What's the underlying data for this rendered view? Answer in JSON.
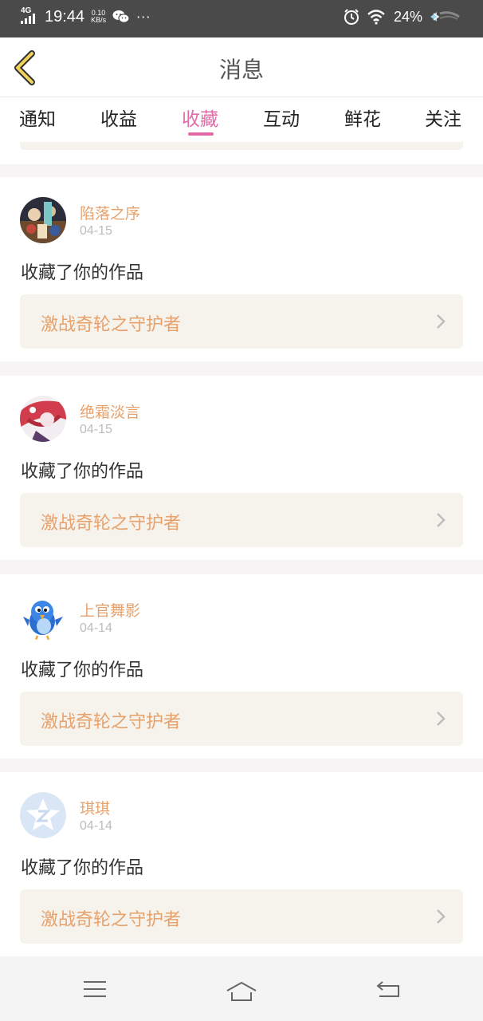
{
  "status_bar": {
    "network": "4G",
    "time": "19:44",
    "speed_value": "0.10",
    "speed_unit": "KB/s",
    "more": "···",
    "battery": "24%"
  },
  "header": {
    "title": "消息"
  },
  "tabs": [
    {
      "label": "通知"
    },
    {
      "label": "收益"
    },
    {
      "label": "收藏"
    },
    {
      "label": "互动"
    },
    {
      "label": "鲜花"
    },
    {
      "label": "关注"
    }
  ],
  "active_tab": "收藏",
  "messages": [
    {
      "user": "陷落之序",
      "date": "04-15",
      "action": "收藏了你的作品",
      "work": "激战奇轮之守护者"
    },
    {
      "user": "绝霜淡言",
      "date": "04-15",
      "action": "收藏了你的作品",
      "work": "激战奇轮之守护者"
    },
    {
      "user": "上官舞影",
      "date": "04-14",
      "action": "收藏了你的作品",
      "work": "激战奇轮之守护者"
    },
    {
      "user": "琪琪",
      "date": "04-14",
      "action": "收藏了你的作品",
      "work": "激战奇轮之守护者"
    }
  ],
  "colors": {
    "accent_pink": "#e36aa8",
    "name_orange": "#e8a16b",
    "card_bg": "#f5f3ec",
    "status_bar": "#4a4a4a"
  },
  "icons": [
    "back-icon",
    "wechat-icon",
    "alarm-icon",
    "wifi-icon",
    "battery-icon",
    "chevron-right-icon",
    "menu-icon",
    "home-icon",
    "return-icon"
  ]
}
